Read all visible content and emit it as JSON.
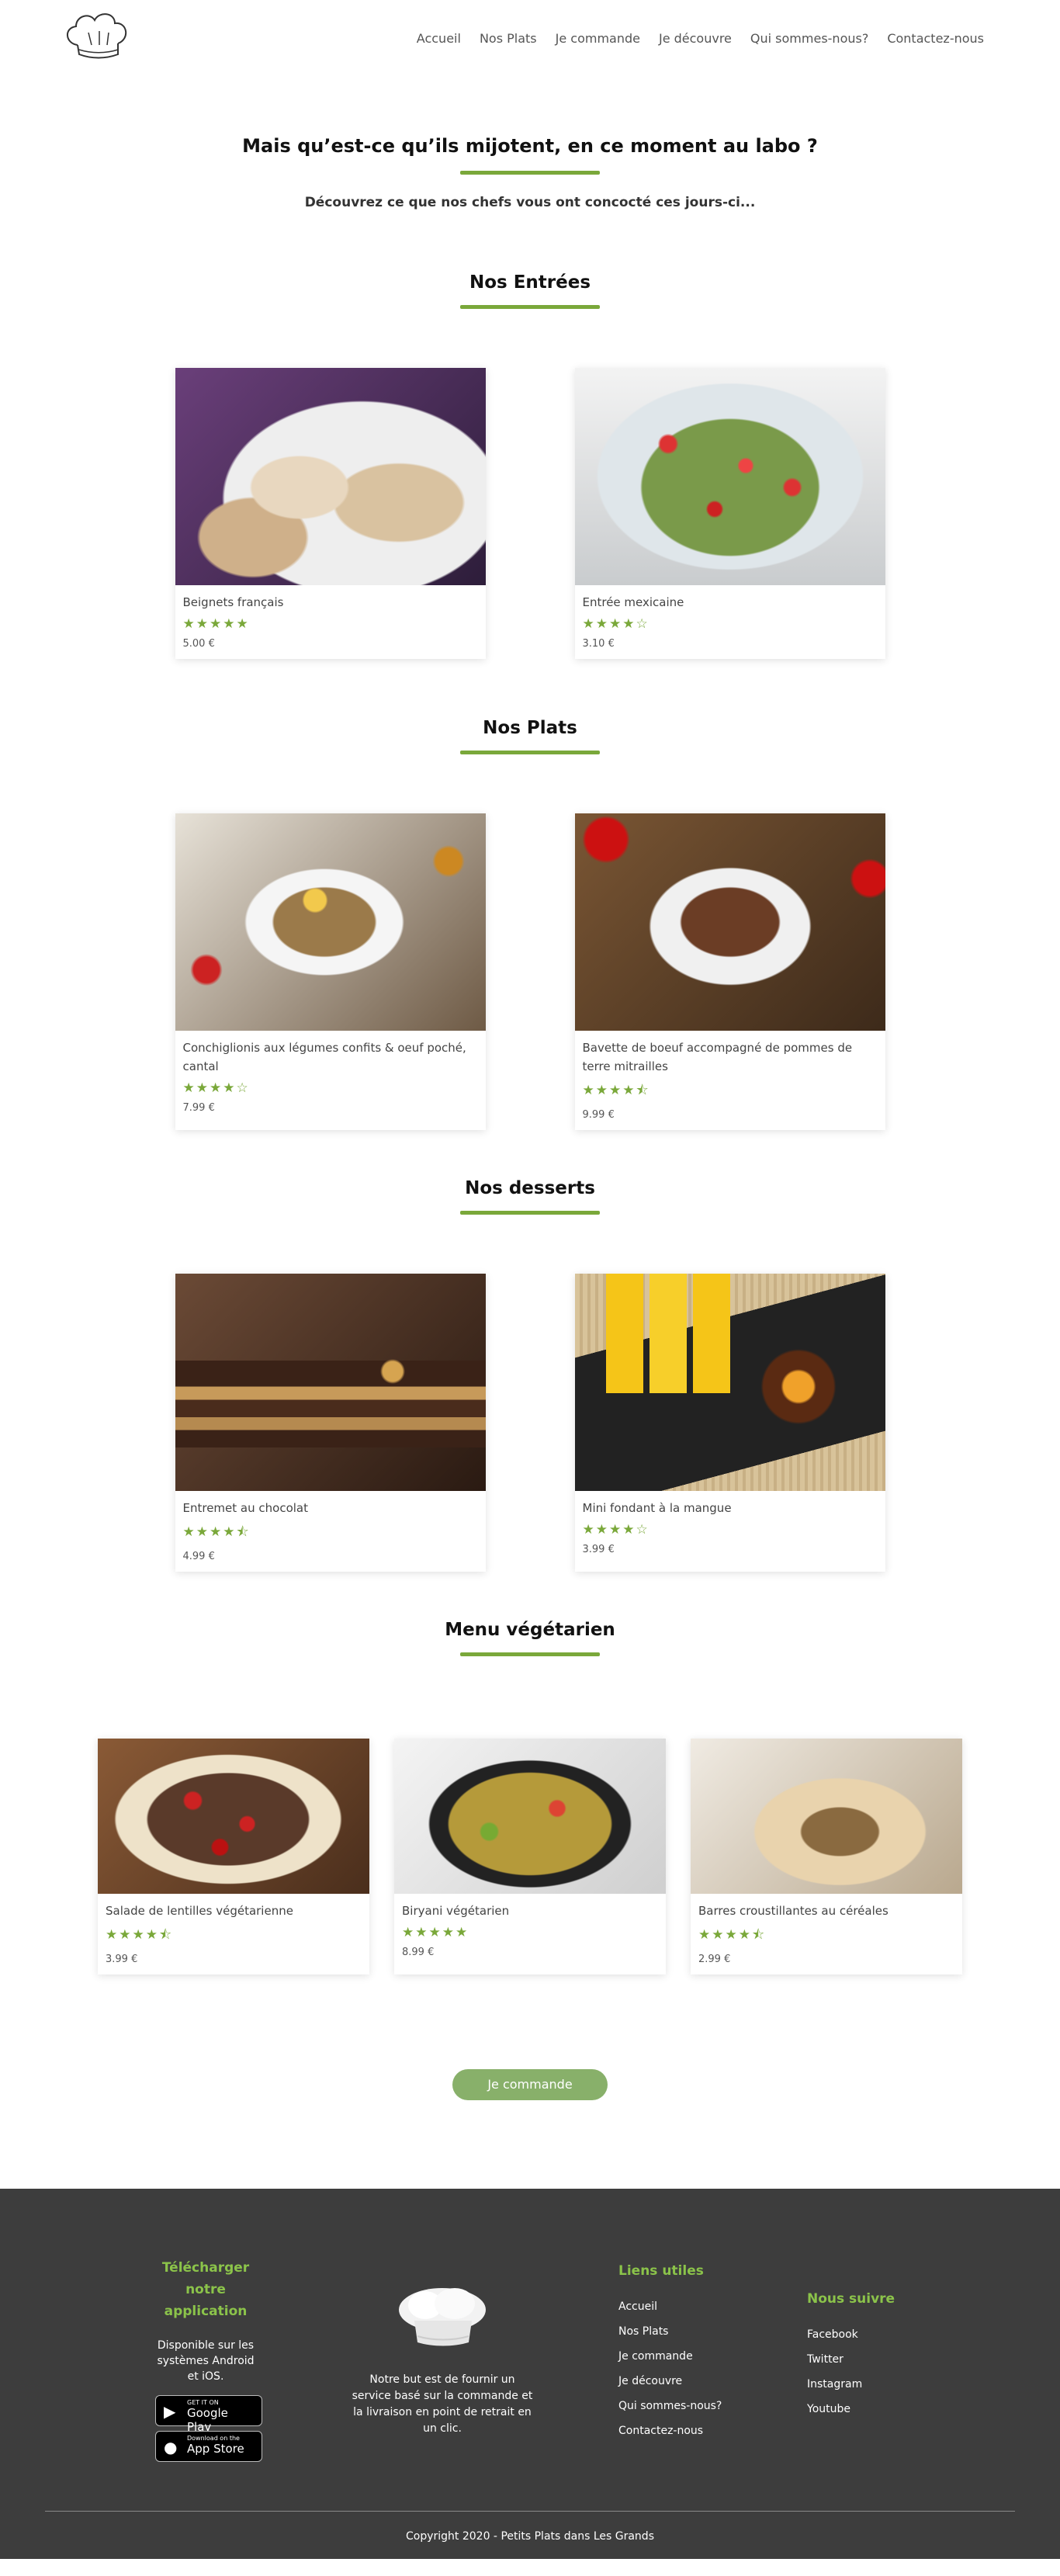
{
  "nav": {
    "links": [
      "Accueil",
      "Nos Plats",
      "Je commande",
      "Je découvre",
      "Qui sommes-nous?",
      "Contactez-nous"
    ]
  },
  "intro": {
    "title": "Mais qu’est-ce qu’ils mijotent, en ce moment au labo ?",
    "subtitle": "Découvrez ce que nos chefs vous ont concocté ces jours-ci..."
  },
  "sections": [
    {
      "title": "Nos Entrées",
      "items": [
        {
          "name": "Beignets français",
          "stars": "★★★★★",
          "rating": 5,
          "price": "5.00 €",
          "image": "beignets"
        },
        {
          "name": "Entrée mexicaine",
          "stars": "★★★★☆",
          "rating": 4,
          "price": "3.10 €",
          "image": "mexicaine"
        }
      ]
    },
    {
      "title": "Nos Plats",
      "items": [
        {
          "name": "Conchiglionis aux légumes confits & oeuf poché, cantal",
          "stars": "★★★★☆",
          "rating": 4,
          "price": "7.99 €",
          "image": "conchi"
        },
        {
          "name": "Bavette de boeuf accompagné de pommes de terre mitrailles",
          "stars": "★★★★⯪",
          "rating": 4.5,
          "price": "9.99 €",
          "image": "bavette"
        }
      ]
    },
    {
      "title": "Nos desserts",
      "items": [
        {
          "name": "Entremet au chocolat",
          "stars": "★★★★⯪",
          "rating": 4.5,
          "price": "4.99 €",
          "image": "chocolat"
        },
        {
          "name": "Mini fondant à la mangue",
          "stars": "★★★★☆",
          "rating": 4,
          "price": "3.99 €",
          "image": "mangue"
        }
      ]
    },
    {
      "title": "Menu végétarien",
      "items": [
        {
          "name": "Salade de lentilles végétarienne",
          "stars": "★★★★⯪",
          "rating": 4.5,
          "price": "3.99 €",
          "image": "salade"
        },
        {
          "name": "Biryani végétarien",
          "stars": "★★★★★",
          "rating": 5,
          "price": "8.99 €",
          "image": "biryani"
        },
        {
          "name": "Barres croustillantes au céréales",
          "stars": "★★★★⯪",
          "rating": 4.5,
          "price": "2.99 €",
          "image": "barres"
        }
      ]
    }
  ],
  "cta": {
    "label": "Je commande"
  },
  "footer": {
    "app": {
      "title": "Télécharger notre application",
      "text": "Disponible sur les systèmes Android et iOS.",
      "google_small": "GET IT ON",
      "google_big": "Google Play",
      "apple_small": "Download on the",
      "apple_big": "App Store"
    },
    "mission": "Notre but est de fournir un service basé sur la commande et la livraison en point de retrait en un clic.",
    "links_title": "Liens utiles",
    "links": [
      "Accueil",
      "Nos Plats",
      "Je commande",
      "Je découvre",
      "Qui sommes-nous?",
      "Contactez-nous"
    ],
    "follow_title": "Nous suivre",
    "follow": [
      "Facebook",
      "Twitter",
      "Instagram",
      "Youtube"
    ],
    "copyright": "Copyright 2020 - Petits Plats dans Les Grands"
  },
  "colors": {
    "accent": "#7aa83a",
    "cta": "#88b06a",
    "footer_bg": "#3d3d3d",
    "footer_heading": "#8bc34a"
  }
}
